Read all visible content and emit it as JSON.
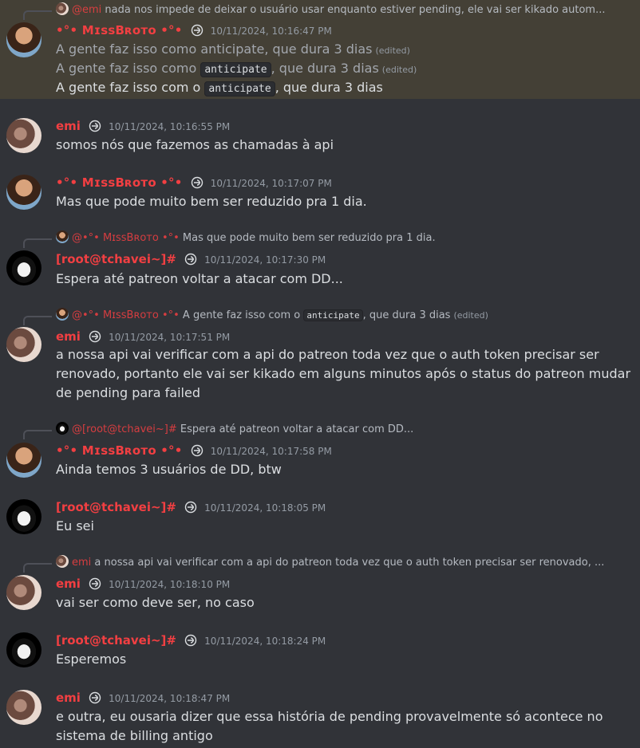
{
  "messages": [
    {
      "reply": {
        "prefix": "@",
        "name": "emi",
        "text": "nada nos impede de deixar o usuário usar enquanto estiver pending, ele vai ser kikado autom..."
      },
      "author": "•°• MɪssBʀᴏᴛᴏ •°•",
      "timestamp": "10/11/2024, 10:16:47 PM",
      "lines": [
        {
          "pre": "A gente faz isso como anticipate, que dura 3 dias",
          "edited": "(edited)"
        },
        {
          "pre": "A gente faz isso como ",
          "code": "anticipate",
          "post": ", que dura 3 dias",
          "edited": "(edited)"
        },
        {
          "pre": "A gente faz isso com o ",
          "code": "anticipate",
          "post": ", que dura 3 dias"
        }
      ]
    },
    {
      "author": "emi",
      "timestamp": "10/11/2024, 10:16:55 PM",
      "lines": [
        "somos nós que fazemos as chamadas à api"
      ]
    },
    {
      "author": "•°• MɪssBʀᴏᴛᴏ •°•",
      "timestamp": "10/11/2024, 10:17:07 PM",
      "lines": [
        "Mas que pode muito bem ser reduzido pra 1 dia."
      ]
    },
    {
      "reply": {
        "prefix": "@",
        "name": "•°• MɪssBʀᴏᴛᴏ •°•",
        "text": "Mas que pode muito bem ser reduzido pra 1 dia."
      },
      "author": "[root@tchavei~]#",
      "timestamp": "10/11/2024, 10:17:30 PM",
      "lines": [
        "Espera até patreon voltar a atacar com DD..."
      ]
    },
    {
      "reply": {
        "prefix": "@",
        "name": "•°• MɪssBʀᴏᴛᴏ •°•",
        "pre": "A gente faz isso com o ",
        "code": "anticipate",
        "post": ", que dura 3 dias",
        "edited": "(edited)"
      },
      "author": "emi",
      "timestamp": "10/11/2024, 10:17:51 PM",
      "lines": [
        "a nossa api vai verificar com a api do patreon toda vez que o auth token precisar ser",
        "renovado, portanto ele vai ser kikado em alguns minutos após o status do patreon mudar",
        "de pending para failed"
      ]
    },
    {
      "reply": {
        "prefix": "@",
        "name": "[root@tchavei~]#",
        "text": "Espera até patreon voltar a atacar com DD..."
      },
      "author": "•°• MɪssBʀᴏᴛᴏ •°•",
      "timestamp": "10/11/2024, 10:17:58 PM",
      "lines": [
        "Ainda temos 3 usuários de DD, btw"
      ]
    },
    {
      "author": "[root@tchavei~]#",
      "timestamp": "10/11/2024, 10:18:05 PM",
      "lines": [
        "Eu sei"
      ]
    },
    {
      "reply": {
        "prefix": "",
        "name": "emi",
        "text": "a nossa api vai verificar com a api do patreon toda vez que o auth token precisar ser renovado, ..."
      },
      "author": "emi",
      "timestamp": "10/11/2024, 10:18:10 PM",
      "lines": [
        "vai ser como deve ser, no caso"
      ]
    },
    {
      "author": "[root@tchavei~]#",
      "timestamp": "10/11/2024, 10:18:24 PM",
      "lines": [
        "Esperemos"
      ]
    },
    {
      "author": "emi",
      "timestamp": "10/11/2024, 10:18:47 PM",
      "lines": [
        "e outra, eu ousaria dizer que essa história de pending provavelmente só acontece no",
        "sistema de billing antigo"
      ]
    }
  ],
  "colors": {
    "background": "#313338",
    "highlight": "#444036",
    "username": "#f23f42",
    "timestamp": "#949ba4"
  }
}
